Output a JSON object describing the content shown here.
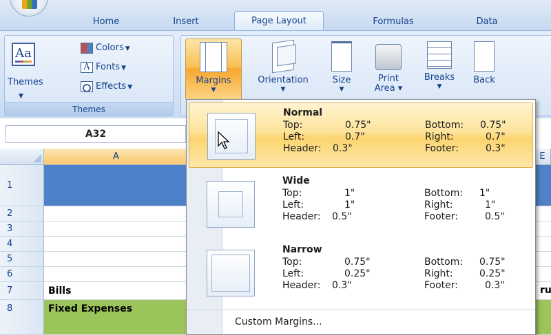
{
  "tabs": [
    "Home",
    "Insert",
    "Page Layout",
    "Formulas",
    "Data"
  ],
  "active_tab": "Page Layout",
  "ribbon": {
    "themes_group": {
      "themes_label": "Themes",
      "colors_label": "Colors",
      "fonts_label": "Fonts",
      "effects_label": "Effects",
      "group_label": "Themes"
    },
    "page_setup": {
      "margins_label": "Margins",
      "orientation_label": "Orientation",
      "size_label": "Size",
      "print_area_label_1": "Print",
      "print_area_label_2": "Area",
      "breaks_label": "Breaks",
      "background_label": "Back"
    }
  },
  "formula_bar": {
    "name_box": "A32"
  },
  "grid": {
    "selected_column": "A",
    "next_column_fragment": "E",
    "rows": [
      {
        "num": "1",
        "text": "",
        "style": "blue"
      },
      {
        "num": "2",
        "text": "",
        "style": ""
      },
      {
        "num": "3",
        "text": "",
        "style": ""
      },
      {
        "num": "4",
        "text": "",
        "style": ""
      },
      {
        "num": "5",
        "text": "",
        "style": ""
      },
      {
        "num": "6",
        "text": "",
        "style": ""
      },
      {
        "num": "7",
        "text": "Bills",
        "style": "",
        "tail": "ru"
      },
      {
        "num": "8",
        "text": "Fixed Expenses",
        "style": "green",
        "tail": ""
      }
    ]
  },
  "margins_menu": {
    "presets": [
      {
        "name": "Normal",
        "top_label": "Top:",
        "top": "0.75\"",
        "left_label": "Left:",
        "left": "0.7\"",
        "header_label": "Header:",
        "header": "0.3\"",
        "bottom_label": "Bottom:",
        "bottom": "0.75\"",
        "right_label": "Right:",
        "right": "0.7\"",
        "footer_label": "Footer:",
        "footer": "0.3\""
      },
      {
        "name": "Wide",
        "top_label": "Top:",
        "top": "1\"",
        "left_label": "Left:",
        "left": "1\"",
        "header_label": "Header:",
        "header": "0.5\"",
        "bottom_label": "Bottom:",
        "bottom": "1\"",
        "right_label": "Right:",
        "right": "1\"",
        "footer_label": "Footer:",
        "footer": "0.5\""
      },
      {
        "name": "Narrow",
        "top_label": "Top:",
        "top": "0.75\"",
        "left_label": "Left:",
        "left": "0.25\"",
        "header_label": "Header:",
        "header": "0.3\"",
        "bottom_label": "Bottom:",
        "bottom": "0.75\"",
        "right_label": "Right:",
        "right": "0.25\"",
        "footer_label": "Footer:",
        "footer": "0.3\""
      }
    ],
    "custom_label": "Custom Margins..."
  },
  "colors": {
    "ribbon_blue": "#d4e3f6",
    "highlight_orange": "#f8c155",
    "row1_blue": "#4f81c9",
    "row8_green": "#9bc45b"
  }
}
